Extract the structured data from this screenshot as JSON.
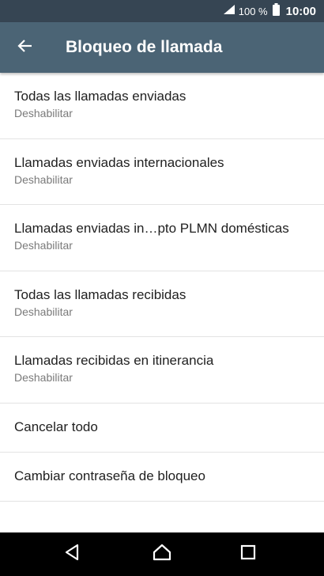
{
  "status_bar": {
    "battery_percent": "100 %",
    "time": "10:00",
    "icons": [
      "signal-icon",
      "battery-icon"
    ]
  },
  "app_bar": {
    "title": "Bloqueo de llamada",
    "back_icon": "arrow-back-icon",
    "background": "#4b6475",
    "status_background": "#364553"
  },
  "settings": {
    "items": [
      {
        "title": "Todas las llamadas enviadas",
        "summary": "Deshabilitar"
      },
      {
        "title": "Llamadas enviadas internacionales",
        "summary": "Deshabilitar"
      },
      {
        "title": "Llamadas enviadas in…pto PLMN domésticas",
        "summary": "Deshabilitar"
      },
      {
        "title": "Todas las llamadas recibidas",
        "summary": "Deshabilitar"
      },
      {
        "title": "Llamadas recibidas en itinerancia",
        "summary": "Deshabilitar"
      },
      {
        "title": "Cancelar todo"
      },
      {
        "title": "Cambiar contraseña de bloqueo"
      }
    ]
  },
  "nav_bar": {
    "icons": [
      "back-triangle-icon",
      "home-icon",
      "recents-icon"
    ]
  }
}
